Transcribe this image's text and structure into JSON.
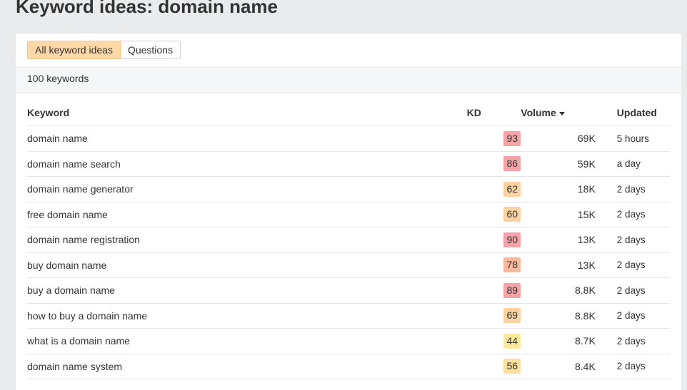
{
  "page": {
    "title": "Keyword ideas: domain name"
  },
  "tabs": [
    {
      "label": "All keyword ideas",
      "active": true
    },
    {
      "label": "Questions",
      "active": false
    }
  ],
  "summary": {
    "count_label": "100 keywords"
  },
  "table": {
    "headers": {
      "keyword": "Keyword",
      "kd": "KD",
      "volume": "Volume",
      "updated": "Updated"
    },
    "sort": {
      "column": "volume",
      "direction": "desc"
    },
    "rows": [
      {
        "keyword": "domain name",
        "kd": "93",
        "kd_color": "#f5a3a6",
        "volume": "69K",
        "updated": "5 hours"
      },
      {
        "keyword": "domain name search",
        "kd": "86",
        "kd_color": "#f5a3a6",
        "volume": "59K",
        "updated": "a day"
      },
      {
        "keyword": "domain name generator",
        "kd": "62",
        "kd_color": "#fcd3a1",
        "volume": "18K",
        "updated": "2 days"
      },
      {
        "keyword": "free domain name",
        "kd": "60",
        "kd_color": "#fcd3a1",
        "volume": "15K",
        "updated": "2 days"
      },
      {
        "keyword": "domain name registration",
        "kd": "90",
        "kd_color": "#f5a3a6",
        "volume": "13K",
        "updated": "2 days"
      },
      {
        "keyword": "buy domain name",
        "kd": "78",
        "kd_color": "#f8b8a0",
        "volume": "13K",
        "updated": "2 days"
      },
      {
        "keyword": "buy a domain name",
        "kd": "89",
        "kd_color": "#f5a3a6",
        "volume": "8.8K",
        "updated": "2 days"
      },
      {
        "keyword": "how to buy a domain name",
        "kd": "69",
        "kd_color": "#fcd3a1",
        "volume": "8.8K",
        "updated": "2 days"
      },
      {
        "keyword": "what is a domain name",
        "kd": "44",
        "kd_color": "#fde99a",
        "volume": "8.7K",
        "updated": "2 days"
      },
      {
        "keyword": "domain name system",
        "kd": "56",
        "kd_color": "#fde0a0",
        "volume": "8.4K",
        "updated": "2 days"
      }
    ]
  }
}
